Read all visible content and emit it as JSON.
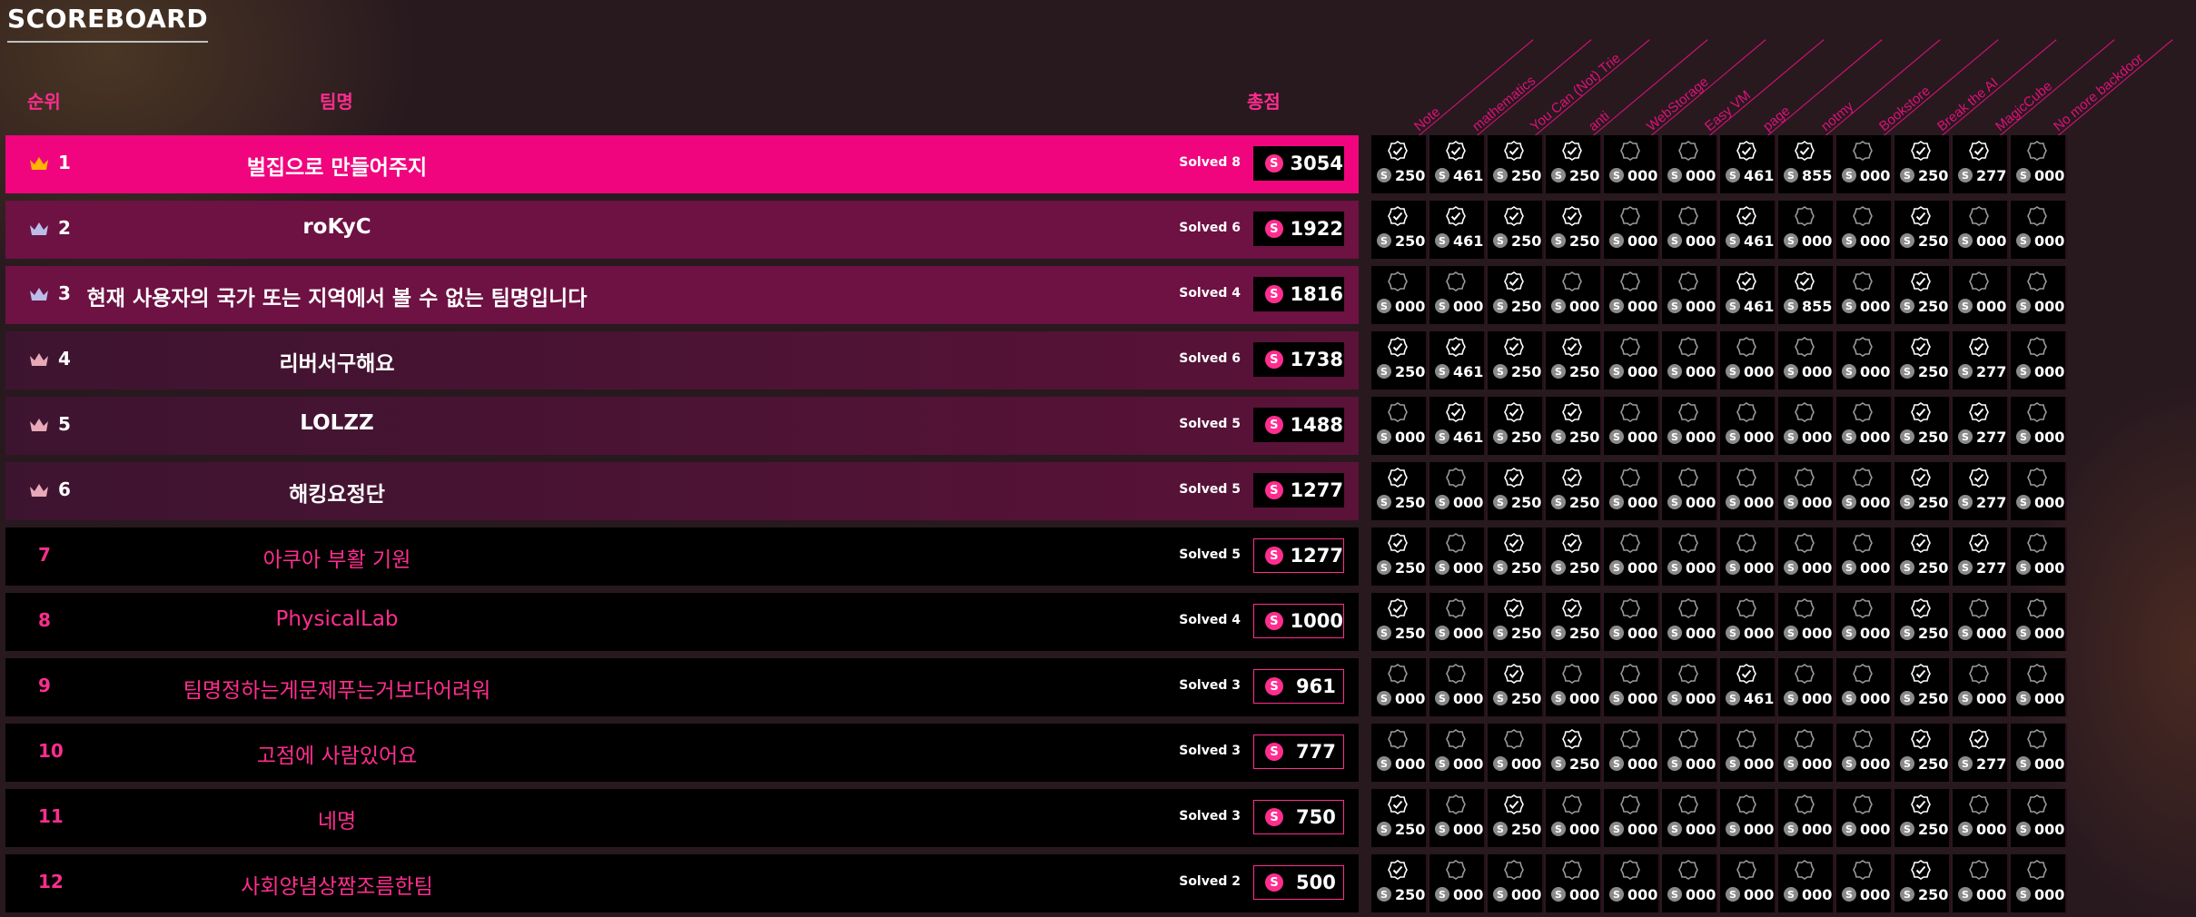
{
  "title": "SCOREBOARD",
  "headers": {
    "rank": "순위",
    "team": "팀명",
    "score": "총점"
  },
  "challenges": [
    "Note",
    "mathematics",
    "You Can (Not) Trie",
    "anti",
    "WebStorage",
    "Easy VM",
    "page",
    "notmy",
    "Bookstore",
    "Break the AI",
    "MagicCube",
    "No more backdoor"
  ],
  "coin_symbol": "S",
  "colors": {
    "accent": "#ff2d8e",
    "top1": "#f0057e",
    "gold": "#ffb400",
    "silver": "#b9bde8",
    "bronze": "#e8a8b8"
  },
  "rows": [
    {
      "rank": "1",
      "team": "벌집으로 만들어주지",
      "solved": "Solved 8",
      "points": "3054",
      "crown": "gold",
      "style": "top1",
      "cells": [
        [
          "s",
          "250"
        ],
        [
          "s",
          "461"
        ],
        [
          "s",
          "250"
        ],
        [
          "s",
          "250"
        ],
        [
          "u",
          "000"
        ],
        [
          "u",
          "000"
        ],
        [
          "s",
          "461"
        ],
        [
          "s",
          "855"
        ],
        [
          "u",
          "000"
        ],
        [
          "s",
          "250"
        ],
        [
          "s",
          "277"
        ],
        [
          "u",
          "000"
        ]
      ]
    },
    {
      "rank": "2",
      "team": "roKyC",
      "solved": "Solved 6",
      "points": "1922",
      "crown": "silver",
      "style": "top2",
      "cells": [
        [
          "s",
          "250"
        ],
        [
          "s",
          "461"
        ],
        [
          "s",
          "250"
        ],
        [
          "s",
          "250"
        ],
        [
          "u",
          "000"
        ],
        [
          "u",
          "000"
        ],
        [
          "s",
          "461"
        ],
        [
          "u",
          "000"
        ],
        [
          "u",
          "000"
        ],
        [
          "s",
          "250"
        ],
        [
          "u",
          "000"
        ],
        [
          "u",
          "000"
        ]
      ]
    },
    {
      "rank": "3",
      "team": "현재 사용자의 국가 또는 지역에서 볼 수 없는 팀명입니다",
      "solved": "Solved 4",
      "points": "1816",
      "crown": "silver",
      "style": "top3",
      "cells": [
        [
          "u",
          "000"
        ],
        [
          "u",
          "000"
        ],
        [
          "s",
          "250"
        ],
        [
          "u",
          "000"
        ],
        [
          "u",
          "000"
        ],
        [
          "u",
          "000"
        ],
        [
          "s",
          "461"
        ],
        [
          "s",
          "855"
        ],
        [
          "u",
          "000"
        ],
        [
          "s",
          "250"
        ],
        [
          "u",
          "000"
        ],
        [
          "u",
          "000"
        ]
      ]
    },
    {
      "rank": "4",
      "team": "리버서구해요",
      "solved": "Solved 6",
      "points": "1738",
      "crown": "bronze",
      "style": "tier",
      "cells": [
        [
          "s",
          "250"
        ],
        [
          "s",
          "461"
        ],
        [
          "s",
          "250"
        ],
        [
          "s",
          "250"
        ],
        [
          "u",
          "000"
        ],
        [
          "u",
          "000"
        ],
        [
          "u",
          "000"
        ],
        [
          "u",
          "000"
        ],
        [
          "u",
          "000"
        ],
        [
          "s",
          "250"
        ],
        [
          "s",
          "277"
        ],
        [
          "u",
          "000"
        ]
      ]
    },
    {
      "rank": "5",
      "team": "LOLZZ",
      "solved": "Solved 5",
      "points": "1488",
      "crown": "bronze",
      "style": "tier",
      "cells": [
        [
          "u",
          "000"
        ],
        [
          "s",
          "461"
        ],
        [
          "s",
          "250"
        ],
        [
          "s",
          "250"
        ],
        [
          "u",
          "000"
        ],
        [
          "u",
          "000"
        ],
        [
          "u",
          "000"
        ],
        [
          "u",
          "000"
        ],
        [
          "u",
          "000"
        ],
        [
          "s",
          "250"
        ],
        [
          "s",
          "277"
        ],
        [
          "u",
          "000"
        ]
      ]
    },
    {
      "rank": "6",
      "team": "해킹요정단",
      "solved": "Solved 5",
      "points": "1277",
      "crown": "bronze",
      "style": "tier",
      "cells": [
        [
          "s",
          "250"
        ],
        [
          "u",
          "000"
        ],
        [
          "s",
          "250"
        ],
        [
          "s",
          "250"
        ],
        [
          "u",
          "000"
        ],
        [
          "u",
          "000"
        ],
        [
          "u",
          "000"
        ],
        [
          "u",
          "000"
        ],
        [
          "u",
          "000"
        ],
        [
          "s",
          "250"
        ],
        [
          "s",
          "277"
        ],
        [
          "u",
          "000"
        ]
      ]
    },
    {
      "rank": "7",
      "team": "아쿠아 부활 기원",
      "solved": "Solved 5",
      "points": "1277",
      "crown": "",
      "style": "plain",
      "cells": [
        [
          "s",
          "250"
        ],
        [
          "u",
          "000"
        ],
        [
          "s",
          "250"
        ],
        [
          "s",
          "250"
        ],
        [
          "u",
          "000"
        ],
        [
          "u",
          "000"
        ],
        [
          "u",
          "000"
        ],
        [
          "u",
          "000"
        ],
        [
          "u",
          "000"
        ],
        [
          "s",
          "250"
        ],
        [
          "s",
          "277"
        ],
        [
          "u",
          "000"
        ]
      ]
    },
    {
      "rank": "8",
      "team": "PhysicalLab",
      "solved": "Solved 4",
      "points": "1000",
      "crown": "",
      "style": "plain",
      "cells": [
        [
          "s",
          "250"
        ],
        [
          "u",
          "000"
        ],
        [
          "s",
          "250"
        ],
        [
          "s",
          "250"
        ],
        [
          "u",
          "000"
        ],
        [
          "u",
          "000"
        ],
        [
          "u",
          "000"
        ],
        [
          "u",
          "000"
        ],
        [
          "u",
          "000"
        ],
        [
          "s",
          "250"
        ],
        [
          "u",
          "000"
        ],
        [
          "u",
          "000"
        ]
      ]
    },
    {
      "rank": "9",
      "team": "팀명정하는게문제푸는거보다어려워",
      "solved": "Solved 3",
      "points": "961",
      "crown": "",
      "style": "plain",
      "cells": [
        [
          "u",
          "000"
        ],
        [
          "u",
          "000"
        ],
        [
          "s",
          "250"
        ],
        [
          "u",
          "000"
        ],
        [
          "u",
          "000"
        ],
        [
          "u",
          "000"
        ],
        [
          "s",
          "461"
        ],
        [
          "u",
          "000"
        ],
        [
          "u",
          "000"
        ],
        [
          "s",
          "250"
        ],
        [
          "u",
          "000"
        ],
        [
          "u",
          "000"
        ]
      ]
    },
    {
      "rank": "10",
      "team": "고점에 사람있어요",
      "solved": "Solved 3",
      "points": "777",
      "crown": "",
      "style": "plain",
      "cells": [
        [
          "u",
          "000"
        ],
        [
          "u",
          "000"
        ],
        [
          "u",
          "000"
        ],
        [
          "s",
          "250"
        ],
        [
          "u",
          "000"
        ],
        [
          "u",
          "000"
        ],
        [
          "u",
          "000"
        ],
        [
          "u",
          "000"
        ],
        [
          "u",
          "000"
        ],
        [
          "s",
          "250"
        ],
        [
          "s",
          "277"
        ],
        [
          "u",
          "000"
        ]
      ]
    },
    {
      "rank": "11",
      "team": "네명",
      "solved": "Solved 3",
      "points": "750",
      "crown": "",
      "style": "plain",
      "cells": [
        [
          "s",
          "250"
        ],
        [
          "u",
          "000"
        ],
        [
          "s",
          "250"
        ],
        [
          "u",
          "000"
        ],
        [
          "u",
          "000"
        ],
        [
          "u",
          "000"
        ],
        [
          "u",
          "000"
        ],
        [
          "u",
          "000"
        ],
        [
          "u",
          "000"
        ],
        [
          "s",
          "250"
        ],
        [
          "u",
          "000"
        ],
        [
          "u",
          "000"
        ]
      ]
    },
    {
      "rank": "12",
      "team": "사회양념상짬조름한팀",
      "solved": "Solved 2",
      "points": "500",
      "crown": "",
      "style": "plain",
      "cells": [
        [
          "s",
          "250"
        ],
        [
          "u",
          "000"
        ],
        [
          "u",
          "000"
        ],
        [
          "u",
          "000"
        ],
        [
          "u",
          "000"
        ],
        [
          "u",
          "000"
        ],
        [
          "u",
          "000"
        ],
        [
          "u",
          "000"
        ],
        [
          "u",
          "000"
        ],
        [
          "s",
          "250"
        ],
        [
          "u",
          "000"
        ],
        [
          "u",
          "000"
        ]
      ]
    }
  ]
}
